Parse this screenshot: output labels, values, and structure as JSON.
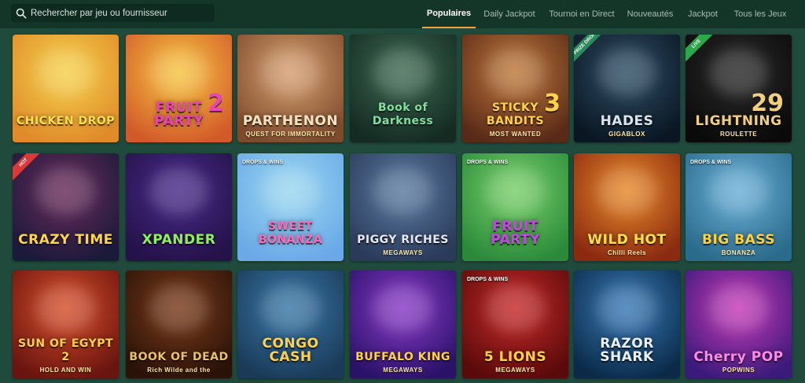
{
  "search": {
    "placeholder": "Rechercher par jeu ou fournisseur"
  },
  "tabs": [
    {
      "label": "Populaires",
      "active": true
    },
    {
      "label": "Daily Jackpot",
      "active": false
    },
    {
      "label": "Tournoi en Direct",
      "active": false
    },
    {
      "label": "Nouveautés",
      "active": false
    },
    {
      "label": "Jackpot",
      "active": false
    },
    {
      "label": "Tous les Jeux",
      "active": false
    }
  ],
  "colors": {
    "background": "#1f4a3c",
    "topbar": "#143629",
    "accent": "#f2a23c"
  },
  "games": [
    {
      "title": "CHICKEN DROP",
      "subtitle": "",
      "number": "",
      "badge": "",
      "drops_wins": false,
      "bg": [
        "#f5d24a",
        "#e08a2a"
      ],
      "title_color": "#ffe04a"
    },
    {
      "title": "FRUIT PARTY",
      "subtitle": "",
      "number": "2",
      "badge": "",
      "drops_wins": false,
      "bg": [
        "#f7c640",
        "#d25a2a"
      ],
      "title_color": "#e845b8"
    },
    {
      "title": "PARTHENON",
      "subtitle": "QUEST FOR IMMORTALITY",
      "number": "",
      "badge": "",
      "drops_wins": false,
      "bg": [
        "#d7a070",
        "#7d4a2c"
      ],
      "title_color": "#f5e3c0"
    },
    {
      "title": "Book of Darkness",
      "subtitle": "",
      "number": "",
      "badge": "",
      "drops_wins": false,
      "bg": [
        "#3f6a52",
        "#142a22"
      ],
      "title_color": "#7fe0a0"
    },
    {
      "title": "STICKY BANDITS",
      "subtitle": "MOST WANTED",
      "number": "3",
      "badge": "",
      "drops_wins": false,
      "bg": [
        "#c07a3c",
        "#5a2a18"
      ],
      "title_color": "#ffd24a"
    },
    {
      "title": "HADES",
      "subtitle": "GIGABLOX",
      "number": "",
      "badge": "PRIZE DROP",
      "drops_wins": false,
      "bg": [
        "#2e4e66",
        "#0a1622"
      ],
      "title_color": "#d8e4ee"
    },
    {
      "title": "LIGHTNING",
      "subtitle": "ROULETTE",
      "number": "29",
      "badge": "LIVE",
      "drops_wins": false,
      "bg": [
        "#2a2a2a",
        "#0a0a0a"
      ],
      "title_color": "#f0d080"
    },
    {
      "title": "CRAZY TIME",
      "subtitle": "",
      "number": "",
      "badge": "HOT",
      "drops_wins": false,
      "bg": [
        "#6a2a5a",
        "#1a1a3a"
      ],
      "title_color": "#ffd54a"
    },
    {
      "title": "XPANDER",
      "subtitle": "",
      "number": "",
      "badge": "",
      "drops_wins": false,
      "bg": [
        "#4a2a8a",
        "#241248"
      ],
      "title_color": "#8ef05a"
    },
    {
      "title": "SWEET BONANZA",
      "subtitle": "",
      "number": "",
      "badge": "",
      "drops_wins": true,
      "bg": [
        "#9ad8f0",
        "#6aa8e8"
      ],
      "title_color": "#ff6ab8"
    },
    {
      "title": "PIGGY RICHES",
      "subtitle": "MEGAWAYS",
      "number": "",
      "badge": "",
      "drops_wins": false,
      "bg": [
        "#5a7aa0",
        "#2a3a5a"
      ],
      "title_color": "#e8e8f0"
    },
    {
      "title": "FRUIT PARTY",
      "subtitle": "",
      "number": "",
      "badge": "",
      "drops_wins": true,
      "bg": [
        "#7ad06a",
        "#2a8a3a"
      ],
      "title_color": "#c845e8"
    },
    {
      "title": "WILD HOT",
      "subtitle": "Chilli Reels",
      "number": "",
      "badge": "",
      "drops_wins": false,
      "bg": [
        "#e88a2a",
        "#8a2a10"
      ],
      "title_color": "#ffe04a"
    },
    {
      "title": "BIG BASS",
      "subtitle": "BONANZA",
      "number": "",
      "badge": "",
      "drops_wins": true,
      "bg": [
        "#6ab0d8",
        "#2a6a8a"
      ],
      "title_color": "#ffd03a"
    },
    {
      "title": "SUN OF EGYPT 2",
      "subtitle": "HOLD AND WIN",
      "number": "",
      "badge": "",
      "drops_wins": false,
      "bg": [
        "#d8502a",
        "#6a1410"
      ],
      "title_color": "#ffd24a"
    },
    {
      "title": "BOOK OF DEAD",
      "subtitle": "Rich Wilde and the",
      "number": "",
      "badge": "",
      "drops_wins": false,
      "bg": [
        "#7a3a1a",
        "#2a1208"
      ],
      "title_color": "#e8c070"
    },
    {
      "title": "CONGO CASH",
      "subtitle": "",
      "number": "",
      "badge": "",
      "drops_wins": false,
      "bg": [
        "#3a78a8",
        "#1a3a58"
      ],
      "title_color": "#ffd24a"
    },
    {
      "title": "BUFFALO KING",
      "subtitle": "MEGAWAYS",
      "number": "",
      "badge": "",
      "drops_wins": false,
      "bg": [
        "#8a3ac8",
        "#2a1268"
      ],
      "title_color": "#ffd24a"
    },
    {
      "title": "5 LIONS",
      "subtitle": "MEGAWAYS",
      "number": "",
      "badge": "",
      "drops_wins": true,
      "bg": [
        "#c82a2a",
        "#5a0a0a"
      ],
      "title_color": "#ffd24a"
    },
    {
      "title": "RAZOR SHARK",
      "subtitle": "",
      "number": "",
      "badge": "",
      "drops_wins": false,
      "bg": [
        "#3a7ab8",
        "#0a2a48"
      ],
      "title_color": "#e8f0f8"
    },
    {
      "title": "Cherry POP",
      "subtitle": "POPWINS",
      "number": "",
      "badge": "",
      "drops_wins": false,
      "bg": [
        "#c83ab8",
        "#3a1a7a"
      ],
      "title_color": "#ff8ae8"
    }
  ],
  "labels": {
    "drops_wins": "DROPS & WINS"
  }
}
